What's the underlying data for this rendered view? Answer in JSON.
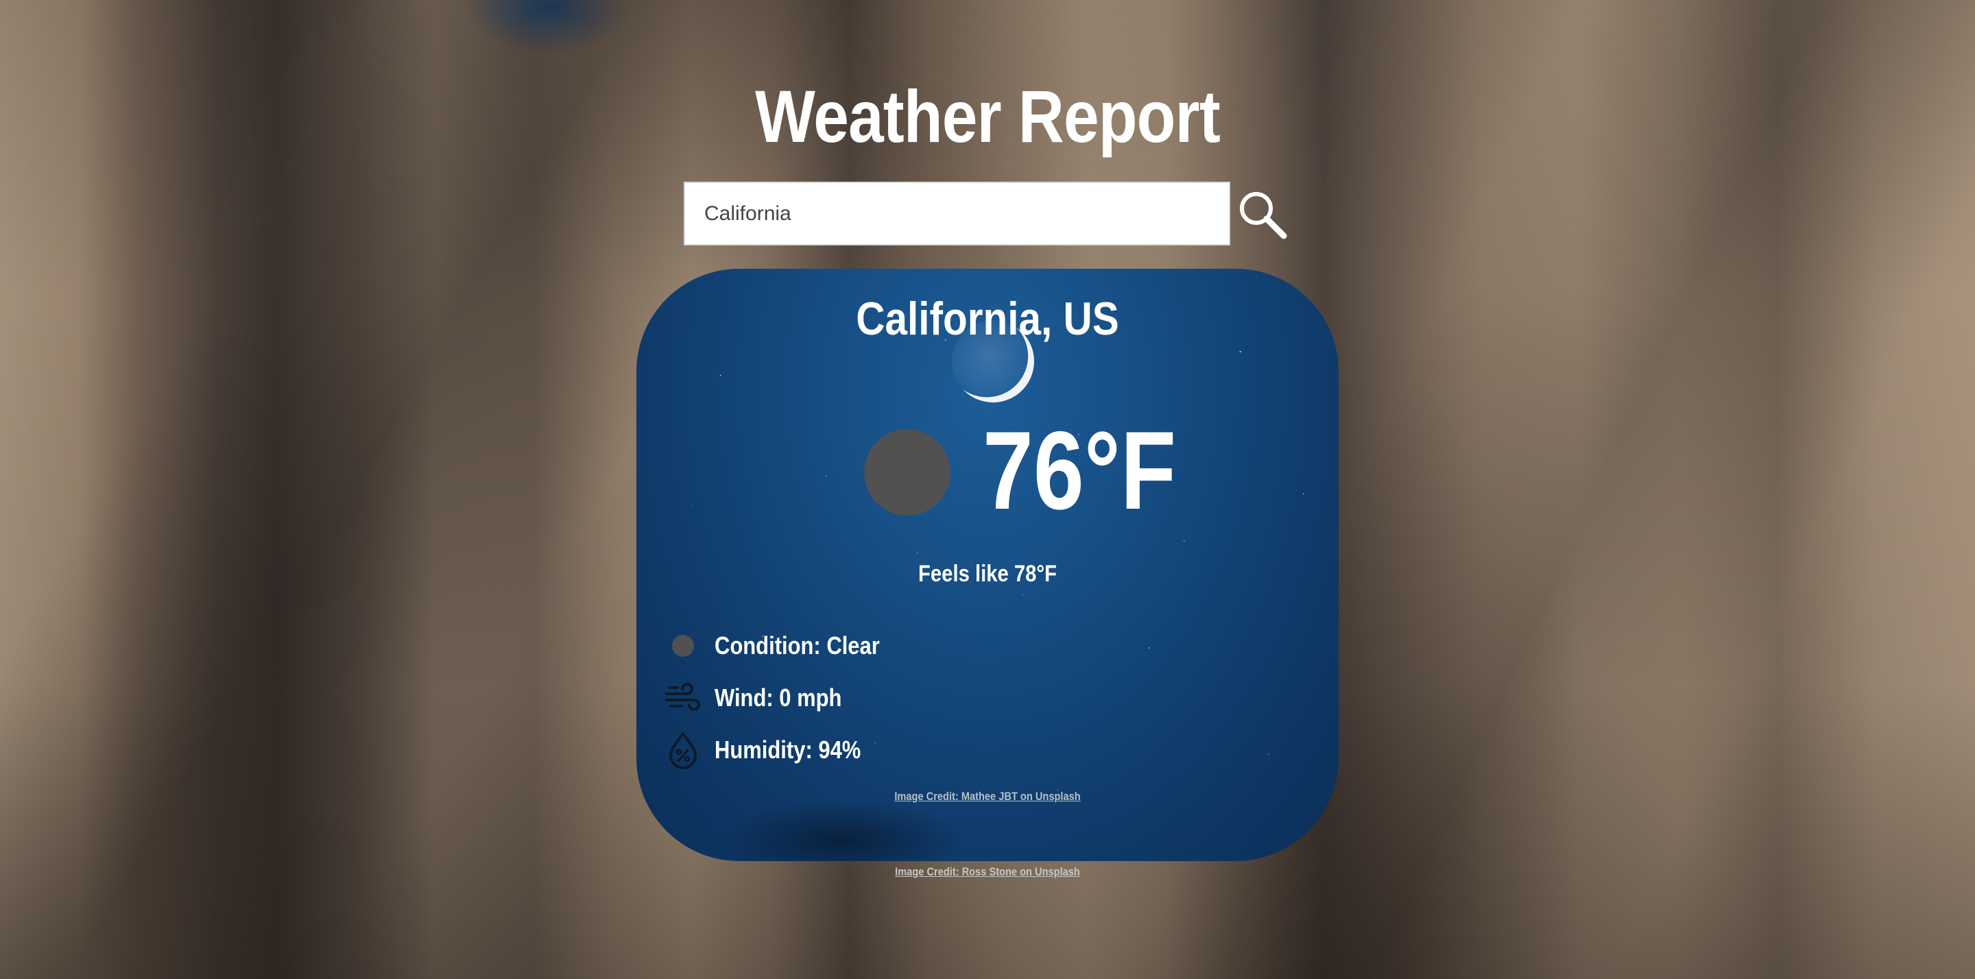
{
  "page": {
    "title": "Weather Report"
  },
  "search": {
    "value": "California",
    "button_icon": "search-icon"
  },
  "card": {
    "location": "California, US",
    "temperature": "76°F",
    "feels_like": "Feels like 78°F",
    "condition": "Condition: Clear",
    "wind": "Wind: 0 mph",
    "humidity": "Humidity: 94%",
    "image_credit": "Image Credit: Mathee JBT on Unsplash"
  },
  "page_credit": "Image Credit: Ross Stone on Unsplash",
  "colors": {
    "card_background": "#164c82",
    "icon_placeholder": "#515151",
    "text": "#ffffff"
  }
}
